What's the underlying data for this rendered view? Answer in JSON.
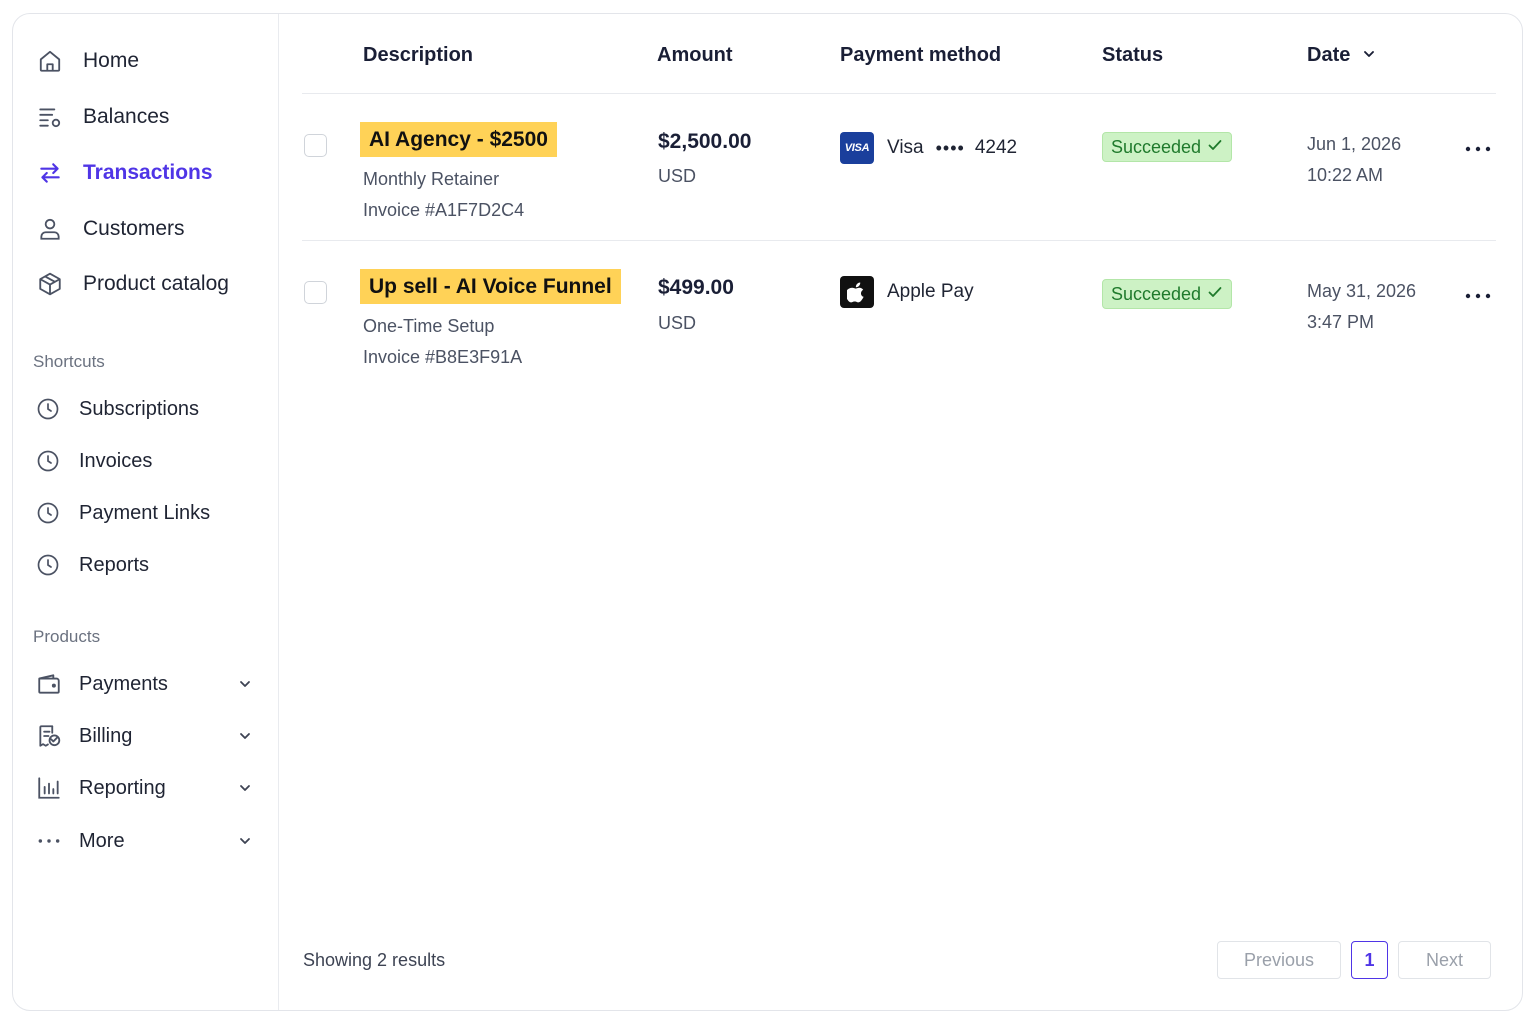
{
  "sidebar": {
    "nav": [
      {
        "label": "Home",
        "icon": "home-icon"
      },
      {
        "label": "Balances",
        "icon": "balances-icon"
      },
      {
        "label": "Transactions",
        "icon": "transactions-icon",
        "active": true
      },
      {
        "label": "Customers",
        "icon": "customers-icon"
      },
      {
        "label": "Product catalog",
        "icon": "product-catalog-icon"
      }
    ],
    "shortcuts_title": "Shortcuts",
    "shortcuts": [
      {
        "label": "Subscriptions",
        "icon": "clock-icon"
      },
      {
        "label": "Invoices",
        "icon": "clock-icon"
      },
      {
        "label": "Payment Links",
        "icon": "clock-icon"
      },
      {
        "label": "Reports",
        "icon": "clock-icon"
      }
    ],
    "products_title": "Products",
    "products": [
      {
        "label": "Payments",
        "icon": "wallet-icon"
      },
      {
        "label": "Billing",
        "icon": "billing-icon"
      },
      {
        "label": "Reporting",
        "icon": "bar-chart-icon"
      },
      {
        "label": "More",
        "icon": "more-horizontal-icon"
      }
    ]
  },
  "table": {
    "headers": {
      "description": "Description",
      "amount": "Amount",
      "payment_method": "Payment method",
      "status": "Status",
      "date": "Date"
    },
    "rows": [
      {
        "title": "AI Agency - $2500",
        "subtitle": "Monthly Retainer",
        "invoice": "Invoice #A1F7D2C4",
        "amount": "$2,500.00",
        "currency": "USD",
        "payment_method": "Visa",
        "card_dots": "••••",
        "card_last4": "4242",
        "card_brand_text": "VISA",
        "status": "Succeeded",
        "date": "Jun 1, 2026",
        "time": "10:22 AM"
      },
      {
        "title": "Up sell - AI Voice Funnel",
        "subtitle": "One-Time Setup",
        "invoice": "Invoice #B8E3F91A",
        "amount": "$499.00",
        "currency": "USD",
        "payment_method": "Apple Pay",
        "status": "Succeeded",
        "date": "May 31, 2026",
        "time": "3:47 PM"
      }
    ]
  },
  "footer": {
    "results_text": "Showing 2 results",
    "previous": "Previous",
    "current_page": "1",
    "next": "Next"
  },
  "colors": {
    "accent": "#4f35e6",
    "highlight": "#ffd257",
    "status_bg": "#cdf2c5",
    "status_text": "#1f7a2c",
    "visa_blue": "#1a3f9c"
  }
}
